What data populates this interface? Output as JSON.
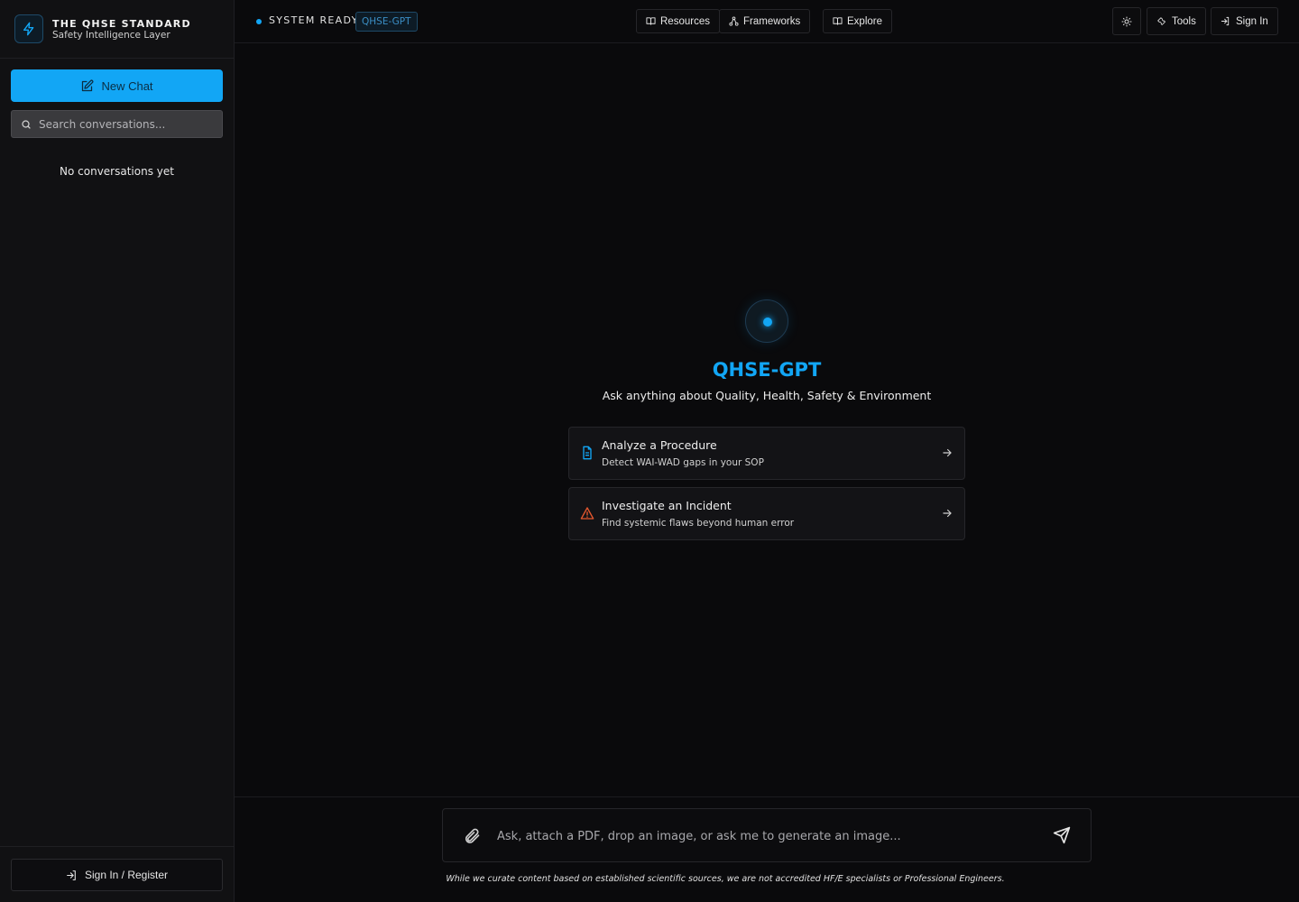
{
  "brand": {
    "title": "THE QHSE STANDARD",
    "subtitle": "Safety Intelligence Layer"
  },
  "sidebar": {
    "new_chat_label": "New Chat",
    "search_placeholder": "Search conversations...",
    "empty_state": "No conversations yet",
    "signin_register_label": "Sign In / Register"
  },
  "header": {
    "status_text": "SYSTEM READY",
    "model_badge": "QHSE-GPT",
    "nav": {
      "resources": "Resources",
      "frameworks": "Frameworks",
      "explore": "Explore"
    },
    "tools_label": "Tools",
    "signin_label": "Sign In"
  },
  "hero": {
    "title": "QHSE-GPT",
    "subtitle": "Ask anything about Quality, Health, Safety & Environment"
  },
  "cards": [
    {
      "title": "Analyze a Procedure",
      "description": "Detect WAI-WAD gaps in your SOP",
      "icon": "document-icon"
    },
    {
      "title": "Investigate an Incident",
      "description": "Find systemic flaws beyond human error",
      "icon": "warning-icon"
    }
  ],
  "composer": {
    "placeholder": "Ask, attach a PDF, drop an image, or ask me to generate an image..."
  },
  "disclaimer": "While we curate content based on established scientific sources, we are not accredited HF/E specialists or Professional Engineers.",
  "colors": {
    "accent": "#12a6f5",
    "background": "#0a0a0c",
    "sidebar": "#111113",
    "warning": "#e4572e"
  }
}
